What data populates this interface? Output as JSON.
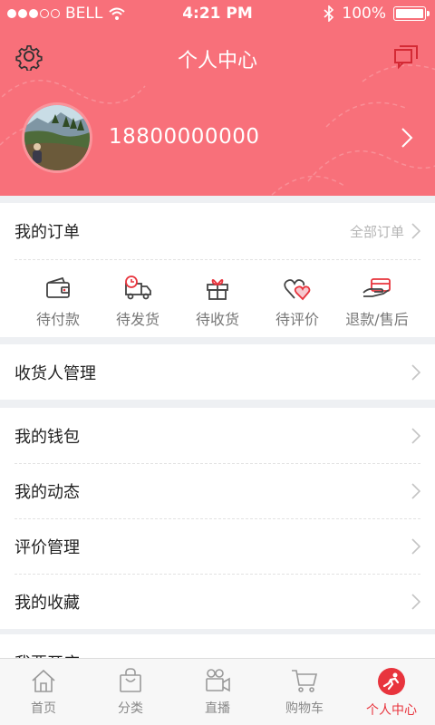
{
  "status_bar": {
    "carrier": "BELL",
    "time": "4:21 PM",
    "battery": "100%",
    "battery_level": 1.0
  },
  "header": {
    "title": "个人中心",
    "settings_icon": "gear-icon",
    "message_icon": "chat-icon"
  },
  "profile": {
    "phone": "18800000000",
    "avatar": "landscape-photo-avatar"
  },
  "orders": {
    "title": "我的订单",
    "all_label": "全部订单",
    "items": [
      {
        "label": "待付款",
        "icon": "wallet-icon"
      },
      {
        "label": "待发货",
        "icon": "truck-icon"
      },
      {
        "label": "待收货",
        "icon": "gift-icon"
      },
      {
        "label": "待评价",
        "icon": "hearts-icon"
      },
      {
        "label": "退款/售后",
        "icon": "refund-card-icon"
      }
    ]
  },
  "menu": {
    "receiver": "收货人管理",
    "wallet": "我的钱包",
    "activity": "我的动态",
    "reviews": "评价管理",
    "favorites": "我的收藏",
    "partial_next": "我要开店"
  },
  "tabbar": {
    "items": [
      {
        "label": "首页",
        "icon": "home-icon"
      },
      {
        "label": "分类",
        "icon": "shopping-bag-icon"
      },
      {
        "label": "直播",
        "icon": "video-camera-icon"
      },
      {
        "label": "购物车",
        "icon": "cart-icon"
      },
      {
        "label": "个人中心",
        "icon": "profile-run-icon"
      }
    ],
    "active_index": 4
  },
  "colors": {
    "brand": "#f8707a",
    "active_tab": "#e8343d",
    "text_gray": "#777777"
  }
}
